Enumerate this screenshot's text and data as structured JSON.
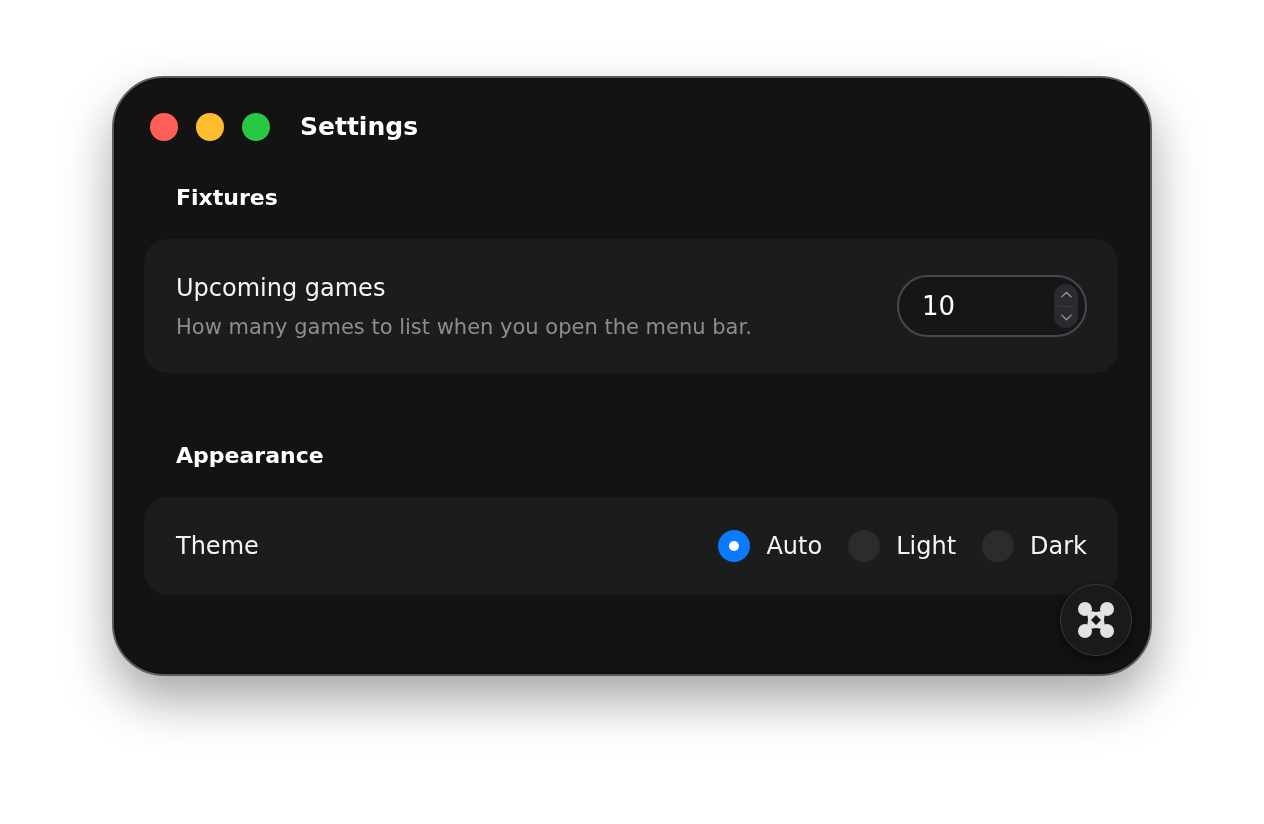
{
  "window": {
    "title": "Settings"
  },
  "sections": [
    {
      "heading": "Fixtures",
      "rows": [
        {
          "kind": "stepper",
          "label": "Upcoming games",
          "description": "How many games to list when you open the menu bar.",
          "value": "10"
        }
      ]
    },
    {
      "heading": "Appearance",
      "rows": [
        {
          "kind": "radio_group",
          "label": "Theme",
          "options": [
            {
              "label": "Auto",
              "selected": true
            },
            {
              "label": "Light",
              "selected": false
            },
            {
              "label": "Dark",
              "selected": false
            }
          ]
        }
      ]
    }
  ]
}
